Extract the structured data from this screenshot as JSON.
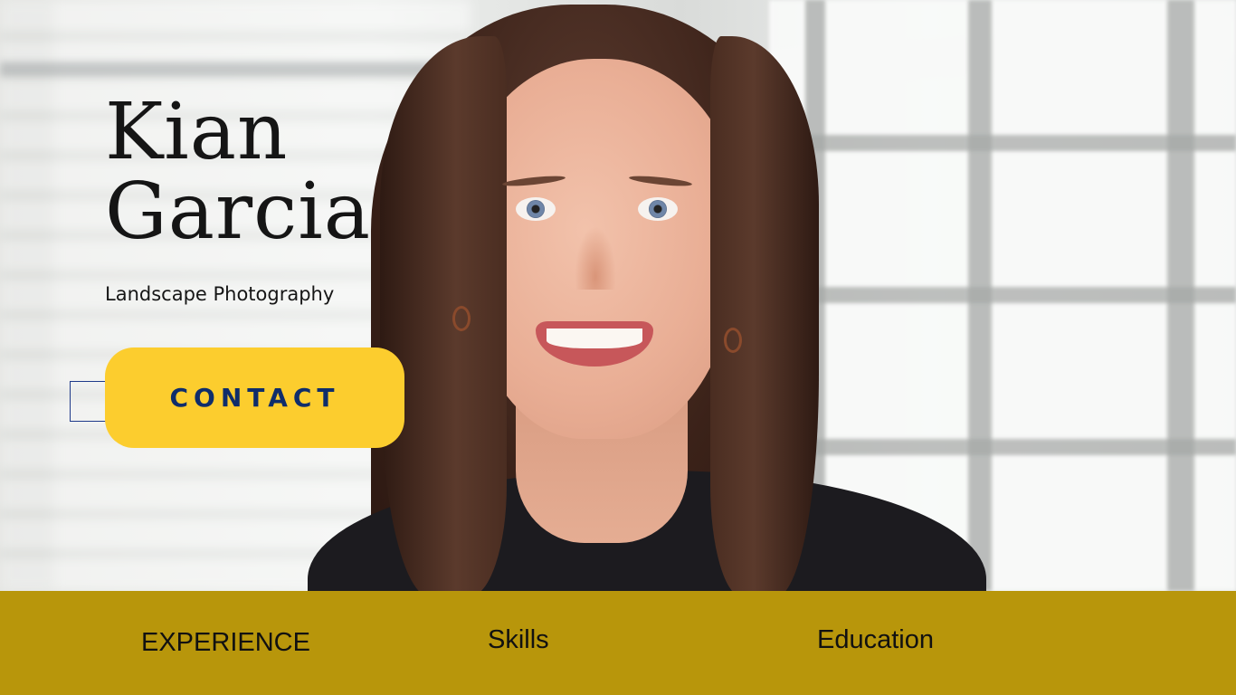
{
  "profile": {
    "first_name": "Kian",
    "last_name": "Garcia",
    "subtitle": "Landscape Photography"
  },
  "cta": {
    "label": "CONTACT"
  },
  "nav": {
    "items": [
      {
        "label": "EXPERIENCE"
      },
      {
        "label": "Skills"
      },
      {
        "label": "Education"
      }
    ]
  },
  "colors": {
    "accent_yellow": "#fccd2e",
    "button_text_navy": "#0f2d6b",
    "nav_bar_mustard": "#b8960b"
  },
  "images": {
    "hero_photo": "portrait of smiling woman with long brown hair in bright office"
  }
}
